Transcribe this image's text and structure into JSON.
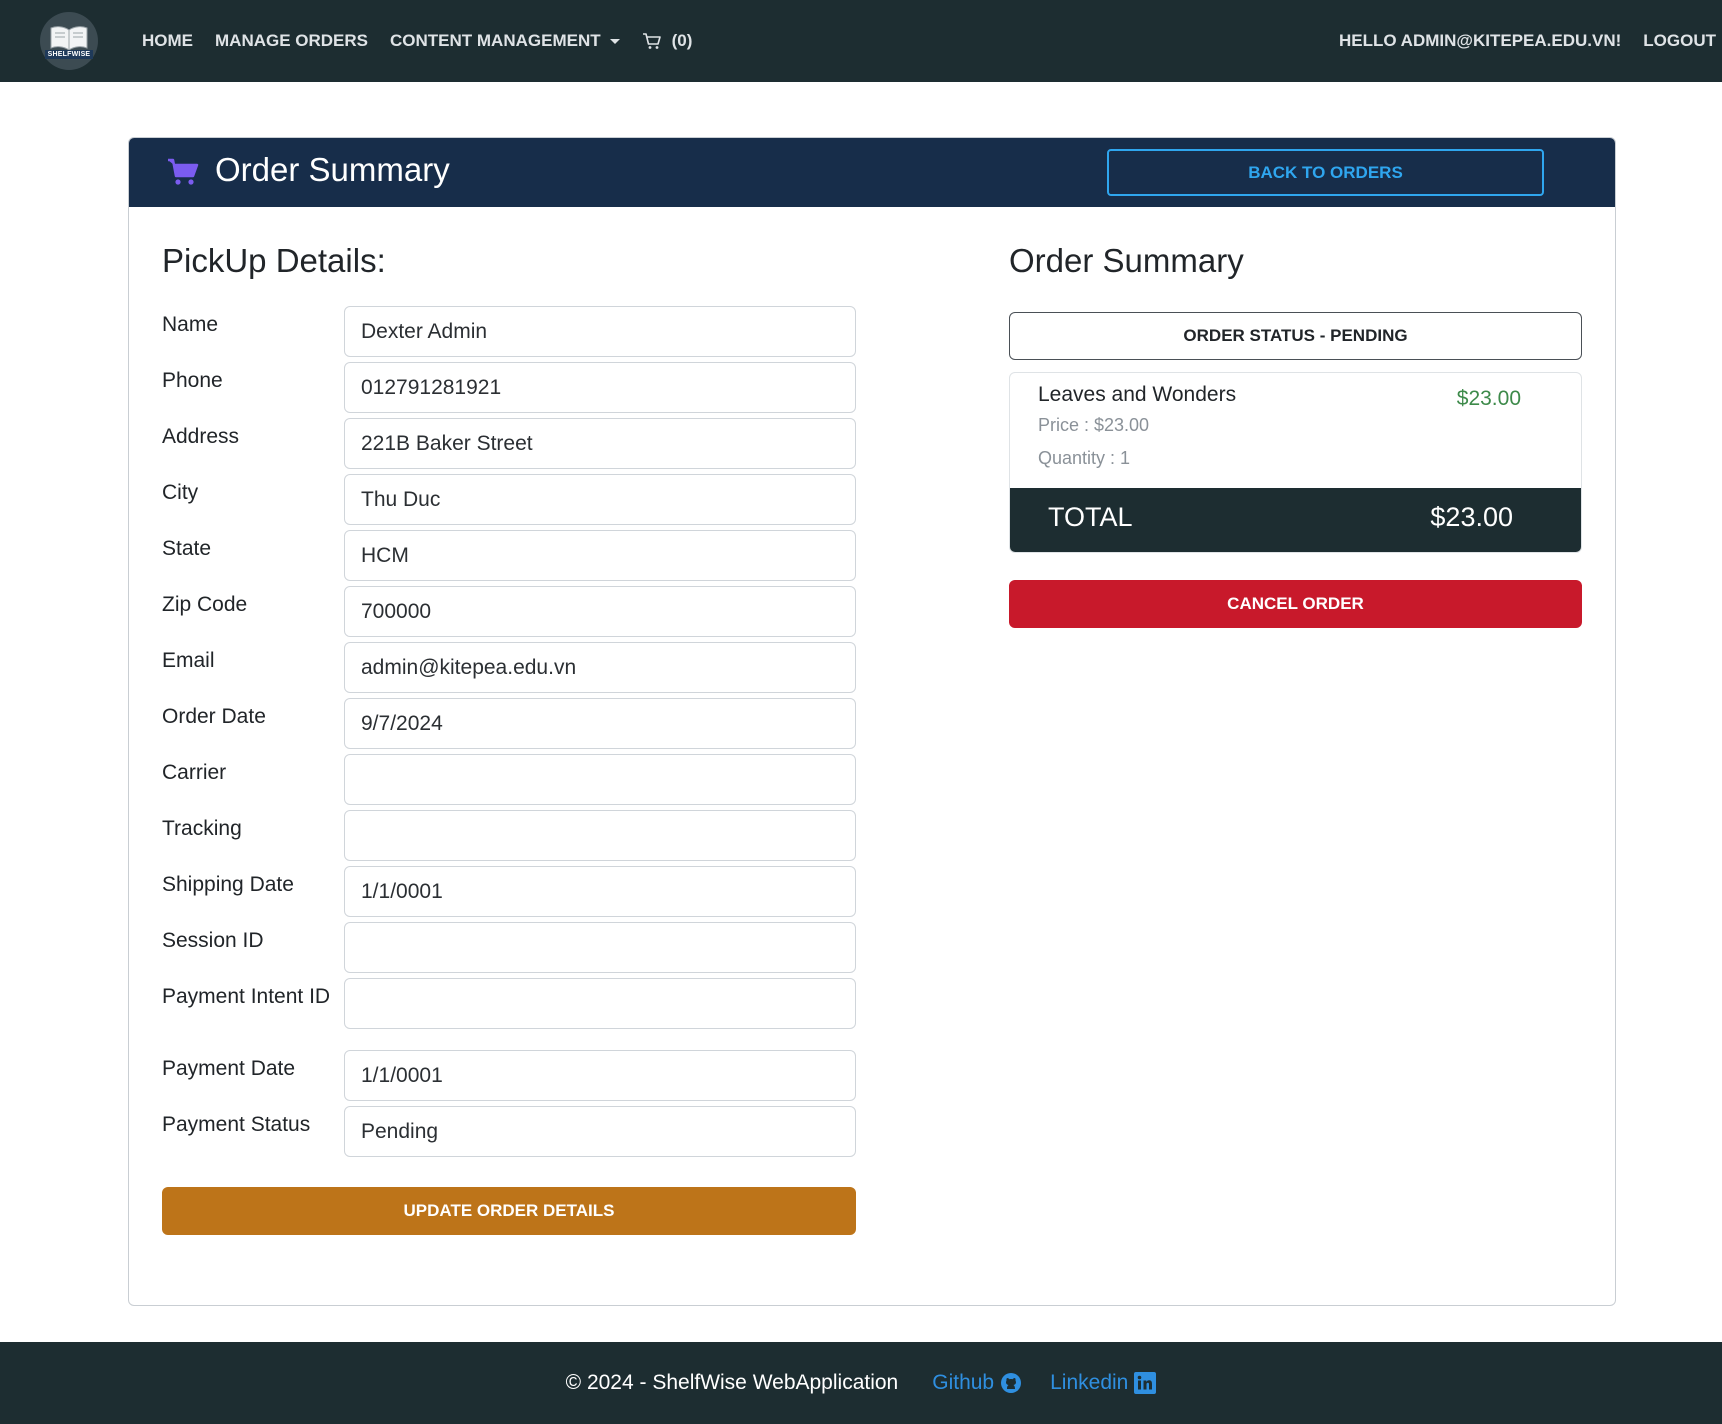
{
  "navbar": {
    "logo_text": "SHELFWISE",
    "links": [
      "Home",
      "Manage Orders",
      "Content Management"
    ],
    "cart_count": "(0)",
    "greeting": "Hello admin@kitepea.edu.vn!",
    "logout": "Logout"
  },
  "card": {
    "title": "Order Summary",
    "back_button": "Back to Orders"
  },
  "pickup": {
    "title": "PickUp Details:",
    "fields": [
      {
        "label": "Name",
        "value": "Dexter Admin"
      },
      {
        "label": "Phone",
        "value": "012791281921"
      },
      {
        "label": "Address",
        "value": "221B Baker Street"
      },
      {
        "label": "City",
        "value": "Thu Duc"
      },
      {
        "label": "State",
        "value": "HCM"
      },
      {
        "label": "Zip Code",
        "value": "700000"
      },
      {
        "label": "Email",
        "value": "admin@kitepea.edu.vn"
      },
      {
        "label": "Order Date",
        "value": "9/7/2024"
      },
      {
        "label": "Carrier",
        "value": ""
      },
      {
        "label": "Tracking",
        "value": ""
      },
      {
        "label": "Shipping Date",
        "value": "1/1/0001"
      },
      {
        "label": "Session ID",
        "value": ""
      },
      {
        "label": "Payment Intent ID",
        "value": ""
      },
      {
        "label": "Payment Date",
        "value": "1/1/0001"
      },
      {
        "label": "Payment Status",
        "value": "Pending"
      }
    ],
    "update_button": "Update Order Details"
  },
  "summary": {
    "title": "Order Summary",
    "status": "Order Status - Pending",
    "item": {
      "name": "Leaves and Wonders",
      "line_total": "$23.00",
      "price": "Price : $23.00",
      "quantity": "Quantity : 1"
    },
    "total_label": "TOTAL",
    "total_value": "$23.00",
    "cancel_button": "Cancel Order"
  },
  "footer": {
    "copyright": "© 2024 - ShelfWise WebApplication",
    "github": "Github",
    "linkedin": "Linkedin"
  },
  "colors": {
    "navbar": "#1d2d31",
    "card_header": "#172d4a",
    "accent_blue": "#2fa6ef",
    "update": "#bd7419",
    "cancel": "#c8192b",
    "price_green": "#3d8a4a",
    "cart_purple": "#7b5cf0"
  }
}
